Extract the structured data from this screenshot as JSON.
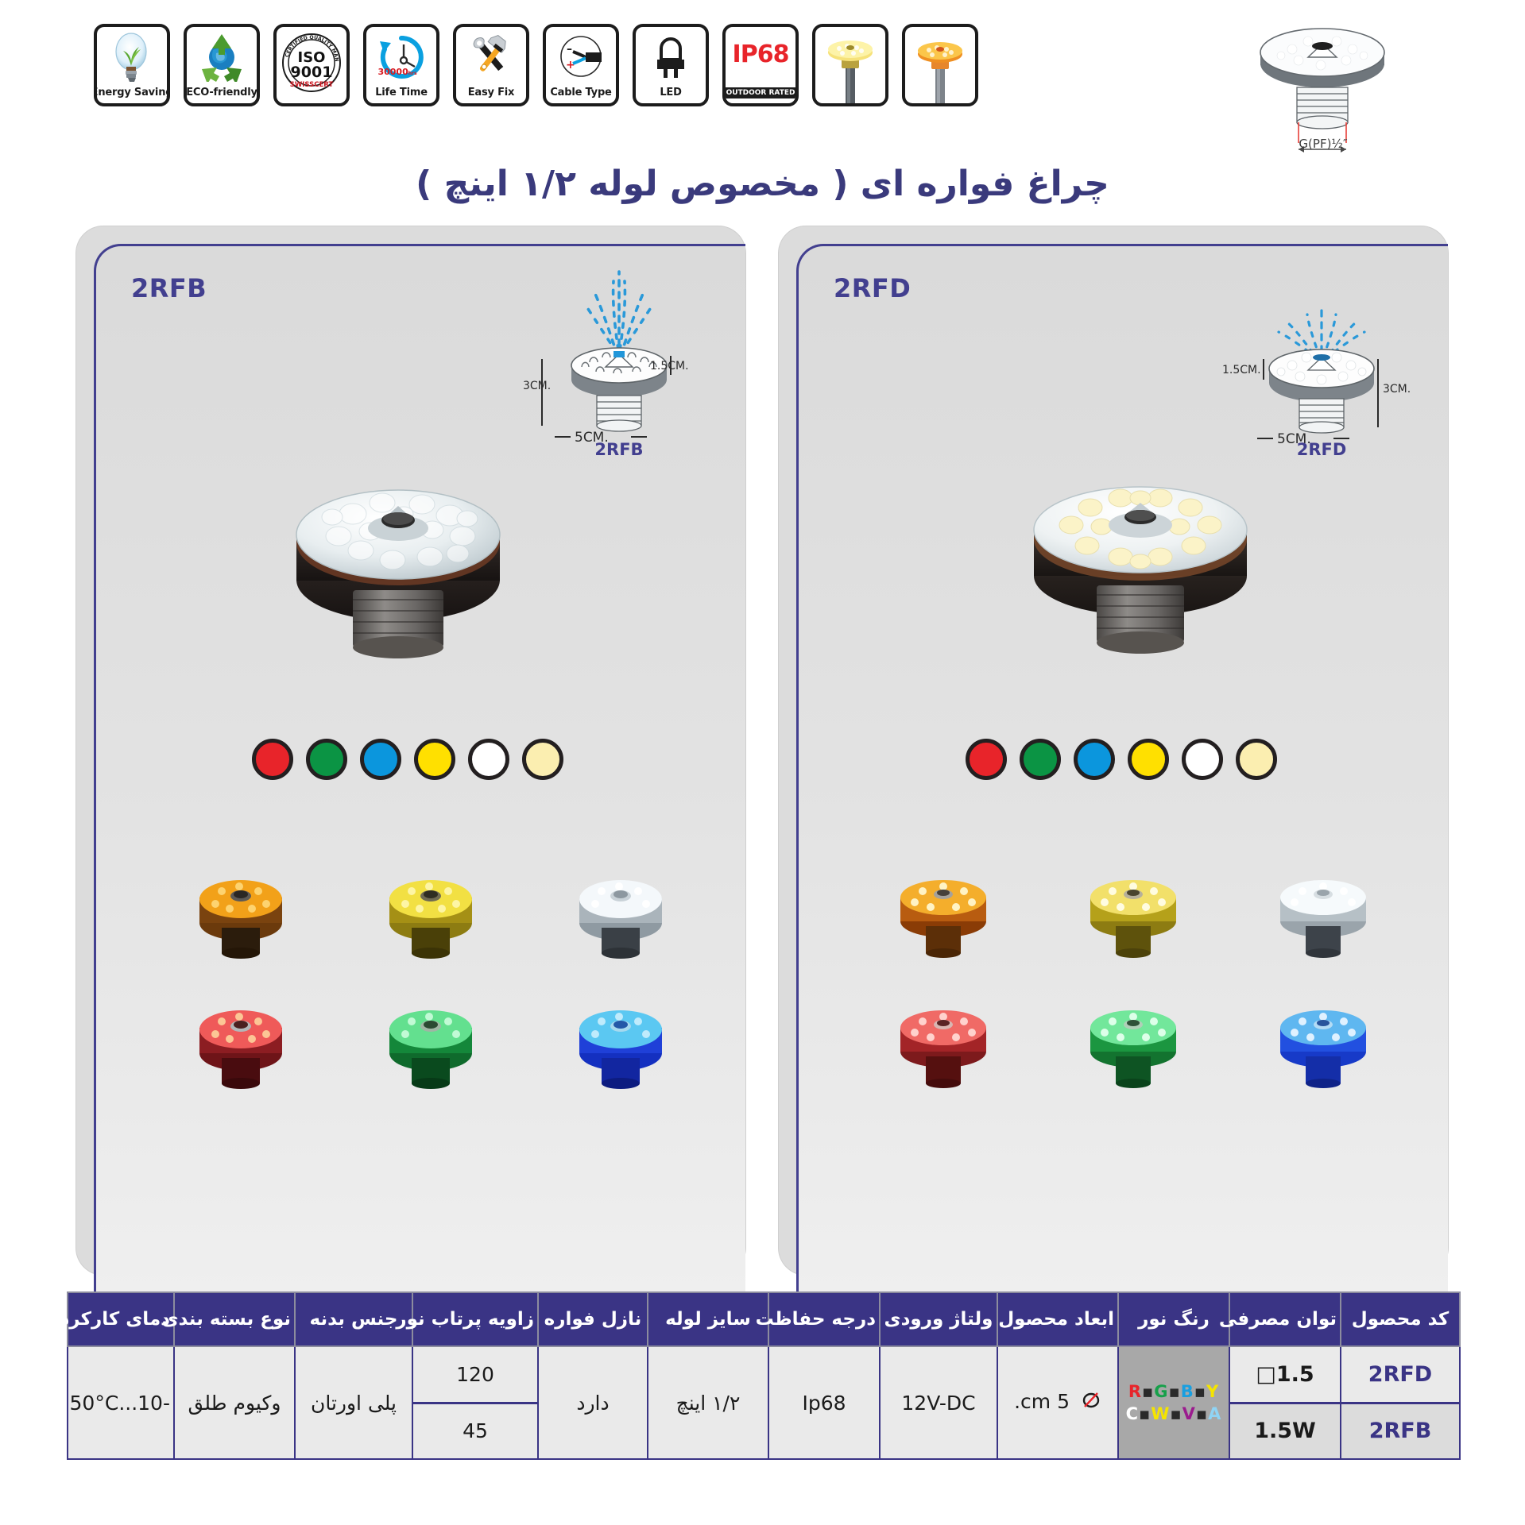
{
  "header": {
    "badges": [
      {
        "icon": "energy-saving-bulb-icon",
        "caption": "Energy Saving"
      },
      {
        "icon": "eco-friendly-recycle-icon",
        "caption": "ECO-friendly"
      },
      {
        "icon": "iso-9001-seal-icon",
        "caption": "",
        "seal_top": "CERTIFIED QUALITY MANAGEMENT SYSTEM",
        "seal_main": "ISO",
        "seal_num": "9001",
        "seal_sub": "SWISSCERT"
      },
      {
        "icon": "life-time-clock-icon",
        "caption": "Life Time",
        "hours": "30000hrs"
      },
      {
        "icon": "easy-fix-tools-icon",
        "caption": "Easy Fix"
      },
      {
        "icon": "cable-type-icon",
        "caption": "Cable Type",
        "minus": "–",
        "plus": "+"
      },
      {
        "icon": "led-component-icon",
        "caption": "LED"
      },
      {
        "icon": "ip68-rating-icon",
        "caption": "",
        "ip": "IP68",
        "ip_sub": "OUTDOOR RATED"
      },
      {
        "icon": "fountain-lamp-photo-yellow-icon",
        "caption": ""
      },
      {
        "icon": "fountain-lamp-photo-orange-icon",
        "caption": ""
      }
    ],
    "tech_drawing": {
      "label": "G(PF)½″",
      "name": "thread-dimension-drawing"
    }
  },
  "title": "چراغ فواره ای ( مخصوص لوله ۱/۲ اینچ )",
  "panels": [
    {
      "code": "2RFB",
      "diagram": {
        "code": "2RFB",
        "left_dim": "3CM.",
        "right_dim": "1.5CM.",
        "width_dim": "5CM."
      },
      "swatches": [
        {
          "name": "swatch-red",
          "hex": "#e8242a"
        },
        {
          "name": "swatch-green",
          "hex": "#0b9444"
        },
        {
          "name": "swatch-blue",
          "hex": "#0b96dd"
        },
        {
          "name": "swatch-yellow",
          "hex": "#ffe000"
        },
        {
          "name": "swatch-white",
          "hex": "#ffffff"
        },
        {
          "name": "swatch-warm-white",
          "hex": "#fbeeb0"
        }
      ],
      "products": [
        {
          "name": "product-amber",
          "hex": "#f2a119"
        },
        {
          "name": "product-yellow",
          "hex": "#f2e043"
        },
        {
          "name": "product-white",
          "hex": "#f4f8fb"
        },
        {
          "name": "product-red",
          "hex": "#ef5a59"
        },
        {
          "name": "product-green",
          "hex": "#63e08f"
        },
        {
          "name": "product-blue",
          "hex": "#5bc8f2"
        }
      ]
    },
    {
      "code": "2RFD",
      "diagram": {
        "code": "2RFD",
        "left_dim": "1.5CM.",
        "right_dim": "3CM.",
        "width_dim": "5CM."
      },
      "swatches": [
        {
          "name": "swatch-red",
          "hex": "#e8242a"
        },
        {
          "name": "swatch-green",
          "hex": "#0b9444"
        },
        {
          "name": "swatch-blue",
          "hex": "#0b96dd"
        },
        {
          "name": "swatch-yellow",
          "hex": "#ffe000"
        },
        {
          "name": "swatch-white",
          "hex": "#ffffff"
        },
        {
          "name": "swatch-warm-white",
          "hex": "#fbeeb0"
        }
      ],
      "products": [
        {
          "name": "product-amber",
          "hex": "#f4ae2c"
        },
        {
          "name": "product-yellow",
          "hex": "#f2e06a"
        },
        {
          "name": "product-white",
          "hex": "#f6fafc"
        },
        {
          "name": "product-red",
          "hex": "#f06a66"
        },
        {
          "name": "product-green",
          "hex": "#72e79b"
        },
        {
          "name": "product-blue",
          "hex": "#5fb7f0"
        }
      ]
    }
  ],
  "spec_table": {
    "headers": [
      "کد محصول",
      "توان مصرفی",
      "رنگ نور",
      "ابعاد محصول",
      "ولتاژ ورودی",
      "درجه حفاظت",
      "سایز لوله",
      "نازل فواره",
      "زاویه پرتاب نور",
      "جنس بدنه",
      "نوع بسته بندی",
      "دمای کارکرد"
    ],
    "product_codes": [
      "2RFD",
      "2RFB"
    ],
    "powers": [
      "1.5□",
      "1.5W"
    ],
    "light_colors_line1": [
      "R",
      "G",
      "B",
      "Y"
    ],
    "light_colors_line2": [
      "C",
      "W",
      "V",
      "A"
    ],
    "dimensions": "5 cm.",
    "dimensions_prefix": "⌀",
    "voltage": "12V-DC",
    "protection": "Ip68",
    "pipe_size": "۱/۲ اینچ",
    "nozzle": "دارد",
    "beam_angles": [
      "120",
      "45"
    ],
    "body_material": "پلی اورتان",
    "packaging": "وکیوم طلق",
    "temperature": "-10...50°C"
  },
  "colors": {
    "brand_purple": "#3a3485",
    "table_header_bg": "#3a3485",
    "accent_red": "#e8242a",
    "water_blue": "#2196d9"
  }
}
